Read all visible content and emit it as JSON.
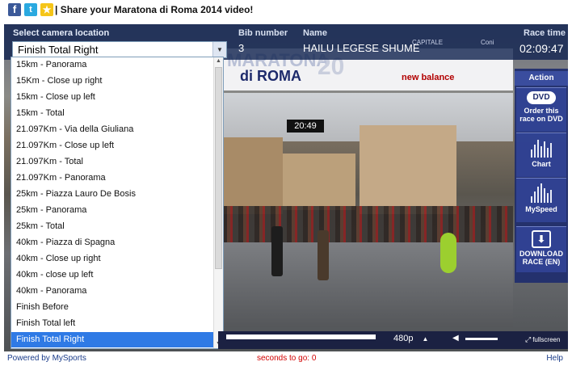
{
  "header": {
    "title": "| Share your Maratona di Roma 2014 video!",
    "social": [
      {
        "name": "facebook-icon",
        "glyph": "f"
      },
      {
        "name": "twitter-icon",
        "glyph": "t"
      },
      {
        "name": "favorite-star-icon",
        "glyph": "★"
      }
    ]
  },
  "info_panel": {
    "camera_label": "Select camera location",
    "bib_label": "Bib number",
    "bib_value": "3",
    "name_label": "Name",
    "name_value": "HAILU LEGESE SHUME",
    "time_label": "Race time",
    "time_value": "02:09:47"
  },
  "camera_select": {
    "selected": "Finish Total Right",
    "options": [
      "15km - Panorama",
      "15Km - Close up right",
      "15km - Close up left",
      "15km - Total",
      "21.097Km - Via della Giuliana",
      "21.097Km - Close up left",
      "21.097Km - Total",
      "21.097Km - Panorama",
      "25km - Piazza Lauro De Bosis",
      "25km - Panorama",
      "25km - Total",
      "40km - Piazza di Spagna",
      "40km - Close up right",
      "40km - close up left",
      "40km - Panorama",
      "Finish Before",
      "Finish Total left",
      "Finish Total Right"
    ],
    "selected_index": 17
  },
  "video": {
    "banner_text_1": "MARATONA",
    "banner_text_2": "di ROMA",
    "banner_sponsor": "new balance",
    "timer": "20:49",
    "sponsor_name_left": "CAPITALE",
    "sponsor_name_right": "Coni"
  },
  "sidebar": {
    "title": "Action",
    "buttons": [
      {
        "label": "Order this race on DVD",
        "icon": "dvd-icon",
        "icon_text": "DVD"
      },
      {
        "label": "Chart",
        "icon": "chart-icon"
      },
      {
        "label": "MySpeed",
        "icon": "speed-icon"
      },
      {
        "label": "DOWNLOAD RACE (EN)",
        "icon": "download-icon"
      }
    ]
  },
  "player_controls": {
    "quality": "480p",
    "fullscreen_label": "fullscreen",
    "progress": 1.0
  },
  "footer": {
    "powered": "Powered by MySports",
    "seconds_to_go": "seconds to go: 0",
    "help": "Help"
  },
  "colors": {
    "panel_bg": "#142652",
    "selected_item": "#2f7ae5",
    "seconds_red": "#d10000",
    "link_blue": "#1a3c8a"
  }
}
